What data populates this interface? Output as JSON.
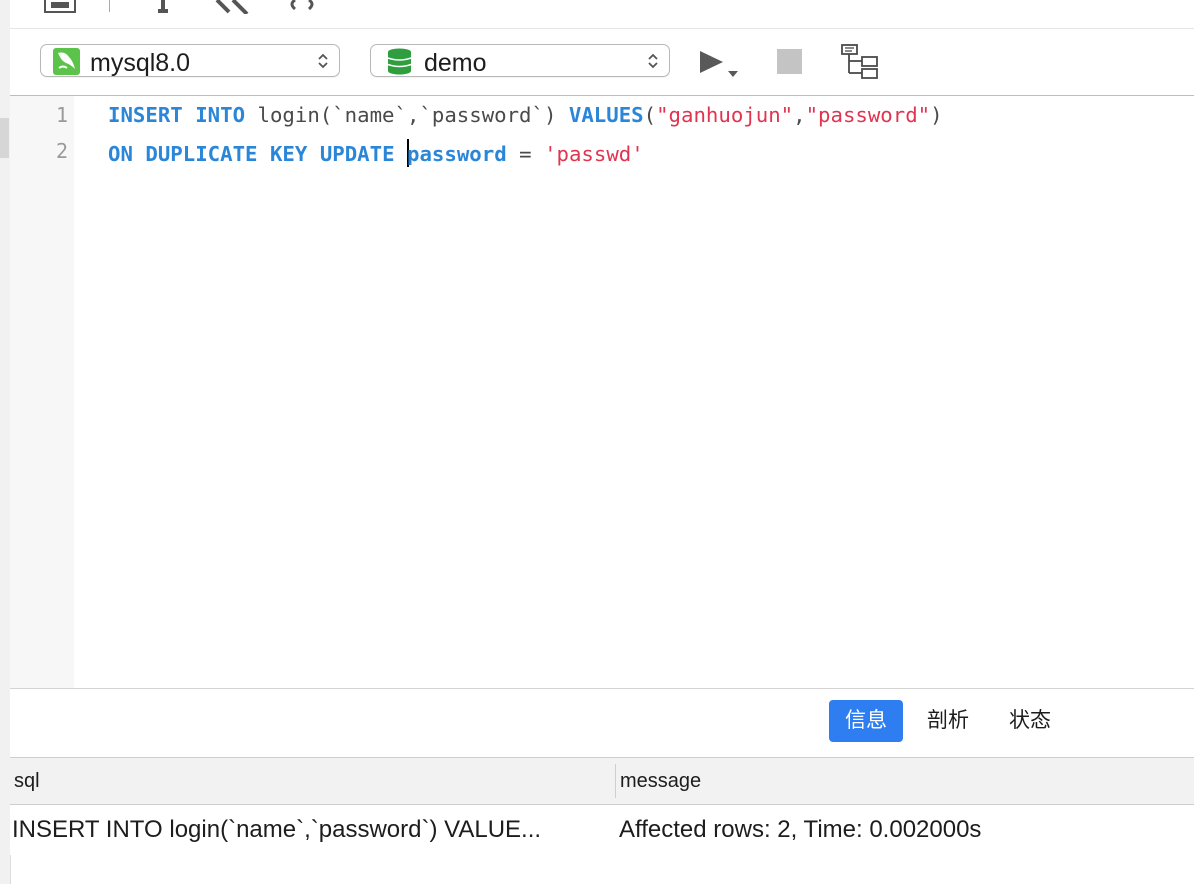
{
  "toolbar": {
    "connection": {
      "label": "mysql8.0",
      "icon": "mysql-dolphin-icon",
      "icon_color": "#5cc34a"
    },
    "database": {
      "label": "demo",
      "icon": "database-icon",
      "icon_color": "#2e9e3e"
    },
    "run_icon": "play-icon",
    "stop_icon": "stop-icon",
    "explain_icon": "explain-tree-icon"
  },
  "editor": {
    "line_numbers": [
      "1",
      "2"
    ],
    "line1": {
      "kw1": "INSERT",
      "kw2": "INTO",
      "plain1": "login(`name`,`password`)",
      "kw3": "VALUES",
      "p_open": "(",
      "str1": "\"ganhuojun\"",
      "comma": ",",
      "str2": "\"password\"",
      "p_close": ")"
    },
    "line2": {
      "kw1": "ON",
      "kw2": "DUPLICATE",
      "kw3": "KEY",
      "kw4": "UPDATE",
      "ident": "password",
      "eq": "=",
      "str": "'passwd'"
    }
  },
  "results": {
    "tabs": [
      {
        "label": "信息",
        "active": true
      },
      {
        "label": "剖析",
        "active": false
      },
      {
        "label": "状态",
        "active": false
      }
    ],
    "columns": [
      "sql",
      "message"
    ],
    "rows": [
      {
        "sql": "INSERT INTO login(`name`,`password`) VALUE...",
        "message": "Affected rows: 2, Time: 0.002000s"
      }
    ]
  },
  "colors": {
    "keyword": "#2b86d8",
    "string": "#e0344f",
    "active_tab": "#2f7ef1"
  }
}
